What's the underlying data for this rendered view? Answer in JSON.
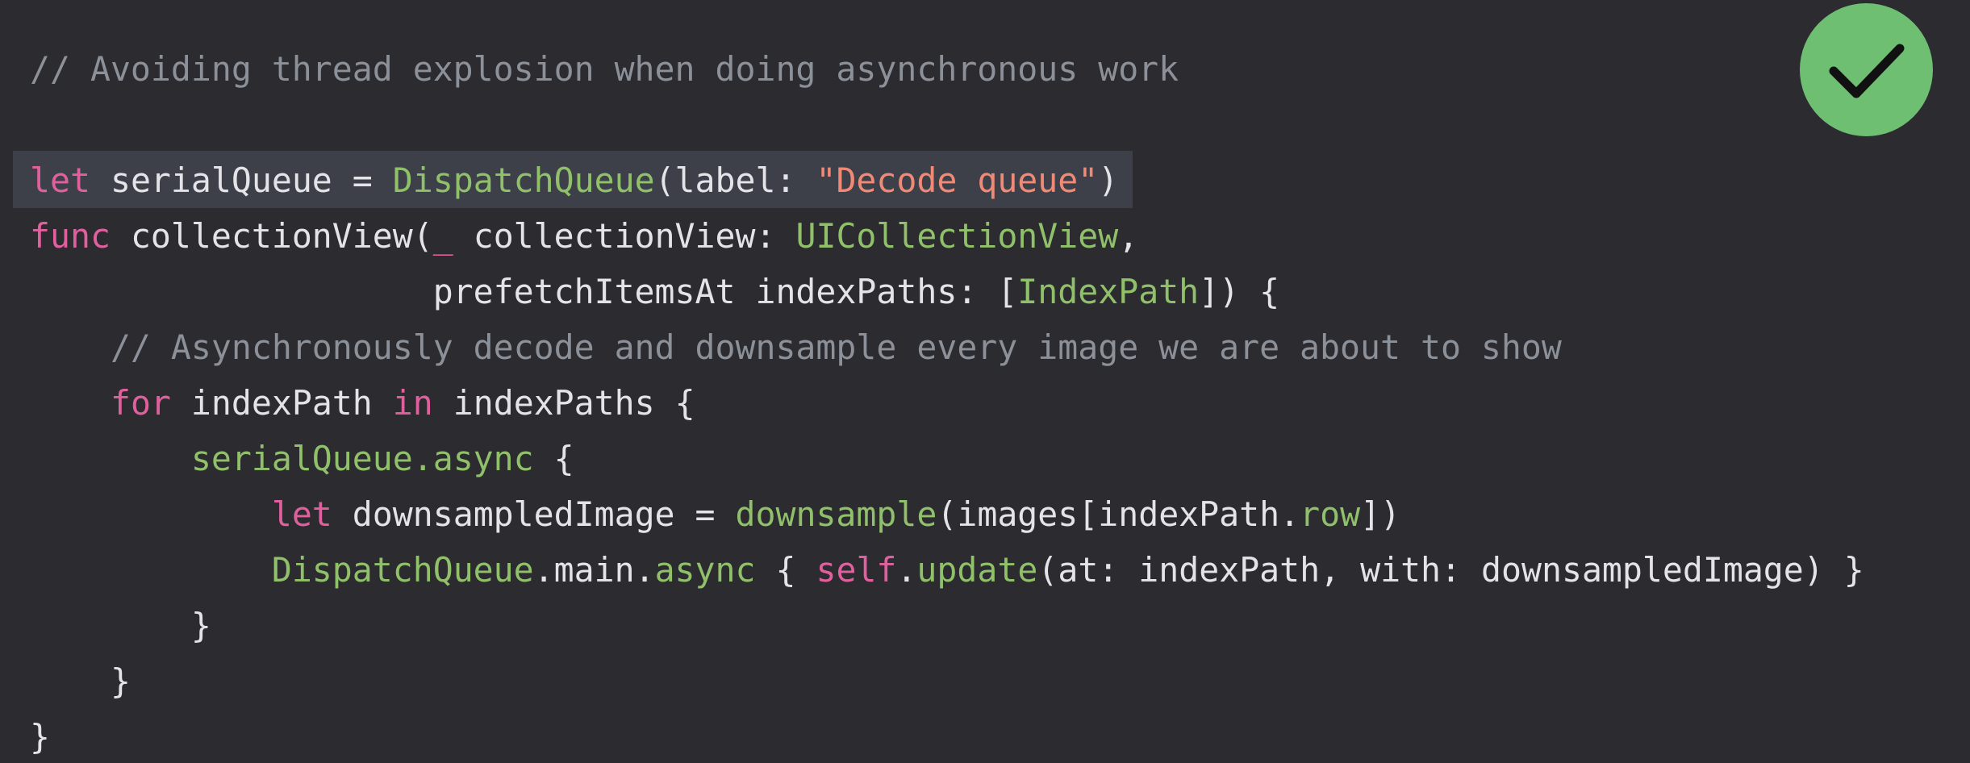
{
  "slide": {
    "status_icon": "checkmark-icon",
    "colors": {
      "background": "#2b2b30",
      "highlight": "#3d4049",
      "comment": "#8c9099",
      "keyword": "#e0609e",
      "type": "#90c06a",
      "string": "#f08a76",
      "plain": "#e4e4e8",
      "check_badge": "#6fbf73"
    }
  },
  "code": {
    "l0": {
      "t0": "// Avoiding thread explosion when doing asynchronous work"
    },
    "l1": {
      "t0": "let",
      "t1": " serialQueue = ",
      "t2": "DispatchQueue",
      "t3": "(label: ",
      "t4": "\"Decode queue\"",
      "t5": ")"
    },
    "l2": {
      "t0": "func",
      "t1": " collectionView(",
      "t2": "_",
      "t3": " collectionView: ",
      "t4": "UICollectionView",
      "t5": ","
    },
    "l3": {
      "t0": "                    prefetchItemsAt indexPaths: [",
      "t1": "IndexPath",
      "t2": "]) {"
    },
    "l4": {
      "t0": "    // Asynchronously decode and downsample every image we are about to show"
    },
    "l5": {
      "t0": "    ",
      "t1": "for",
      "t2": " indexPath ",
      "t3": "in",
      "t4": " indexPaths {"
    },
    "l6": {
      "t0": "        ",
      "t1": "serialQueue.async",
      "t2": " {"
    },
    "l7": {
      "t0": "            ",
      "t1": "let",
      "t2": " downsampledImage = ",
      "t3": "downsample",
      "t4": "(images[indexPath.",
      "t5": "row",
      "t6": "])"
    },
    "l8": {
      "t0": "            ",
      "t1": "DispatchQueue",
      "t2": ".main.",
      "t3": "async",
      "t4": " { ",
      "t5": "self",
      "t6": ".",
      "t7": "update",
      "t8": "(at: indexPath, with: downsampledImage) }"
    },
    "l9": {
      "t0": "        }"
    },
    "l10": {
      "t0": "    }"
    },
    "l11": {
      "t0": "}"
    }
  }
}
